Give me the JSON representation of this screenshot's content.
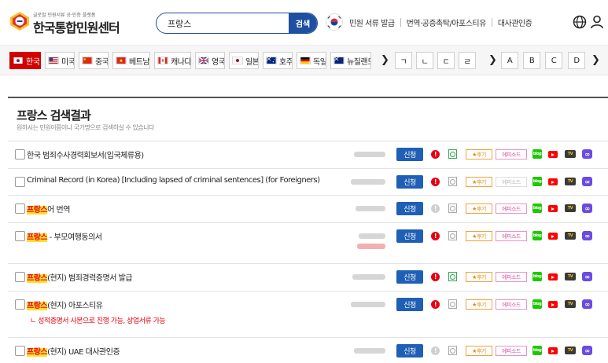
{
  "header": {
    "logo_small": "글로벌 민원서류 공·인증 플랫폼",
    "logo_main": "한국통합민원센터",
    "search": {
      "value": "프랑스",
      "placeholder": "",
      "button": "검색"
    },
    "nav": [
      "민원 서류 발급",
      "번역·공증촉탁/아포스티유",
      "대사관인증"
    ]
  },
  "countries": [
    {
      "label": "한국",
      "flag": "korea",
      "active": true
    },
    {
      "label": "미국",
      "flag": "usa",
      "active": false
    },
    {
      "label": "중국",
      "flag": "china",
      "active": false
    },
    {
      "label": "베트남",
      "flag": "vietnam",
      "active": false
    },
    {
      "label": "캐나다",
      "flag": "canada",
      "active": false
    },
    {
      "label": "영국",
      "flag": "uk",
      "active": false
    },
    {
      "label": "일본",
      "flag": "japan",
      "active": false
    },
    {
      "label": "호주",
      "flag": "australia",
      "active": false
    },
    {
      "label": "독일",
      "flag": "germany",
      "active": false
    },
    {
      "label": "뉴질랜드",
      "flag": "newzealand",
      "active": false
    }
  ],
  "index_letters": [
    "ㄱ",
    "ㄴ",
    "ㄷ",
    "ㄹ",
    "A",
    "B",
    "C",
    "D"
  ],
  "results": {
    "title": "프랑스 검색결과",
    "subtitle": "원하시는 민원이름이나 국가명으로 검색하실 수 있습니다",
    "apply_label": "신청",
    "review_label": "★후기",
    "episode_label": "에피소드",
    "info_glyph": "!",
    "naver_label": "blog",
    "tv_label": "TV",
    "link_glyph": "∞",
    "items": [
      {
        "pre": "",
        "hl": "",
        "post": "한국 범죄수사경력회보서(입국체류용)",
        "note": "",
        "info_on": true,
        "mag_on": true,
        "ep_on": true
      },
      {
        "pre": "",
        "hl": "",
        "post": "Criminal Record (in Korea) [Including lapsed of criminal sentences] (for Foreigners)",
        "note": "",
        "info_on": true,
        "mag_on": false,
        "ep_on": false
      },
      {
        "pre": "",
        "hl": "프랑스",
        "post": "어 번역",
        "note": "",
        "info_on": false,
        "mag_on": false,
        "ep_on": true
      },
      {
        "pre": "",
        "hl": "프랑스",
        "post": " - 부모여행동의서",
        "note": "",
        "info_on": true,
        "mag_on": false,
        "ep_on": true
      },
      {
        "pre": "",
        "hl": "프랑스",
        "post": "(현지) 범죄경력증명서 발급",
        "note": "",
        "info_on": true,
        "mag_on": true,
        "ep_on": true
      },
      {
        "pre": "",
        "hl": "프랑스",
        "post": "(현지) 아포스티유",
        "note": "ㄴ 성적증명서 사본으로 진행 가능, 상업서류 가능",
        "info_on": true,
        "mag_on": false,
        "ep_on": true
      },
      {
        "pre": "",
        "hl": "프랑스",
        "post": "(현지) UAE 대사관인증",
        "note": "",
        "info_on": false,
        "mag_on": false,
        "ep_on": true
      }
    ]
  },
  "icons": {
    "logo": "government-seal-icon",
    "flag_circle": "korea-flag-icon",
    "globe": "globe-icon",
    "user": "user-icon",
    "arrow": "chevron-right-icon"
  },
  "colors": {
    "primary_blue": "#1f4fa0",
    "active_red": "#d40000",
    "highlight_yellow": "#ffde2e",
    "highlight_text": "#e60012"
  }
}
